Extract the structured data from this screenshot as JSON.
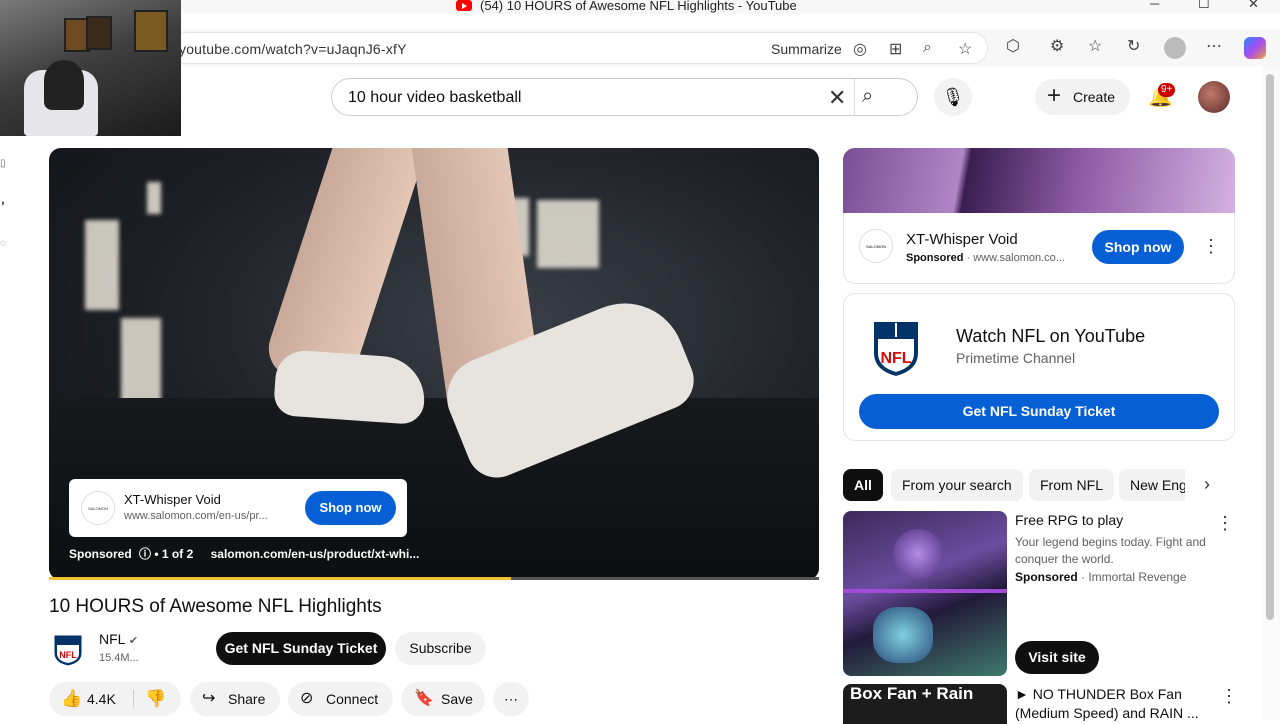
{
  "window": {
    "title": "(54) 10 HOURS of Awesome NFL Highlights - YouTube",
    "minimize": "─",
    "maximize": "☐",
    "close": "✕"
  },
  "browser": {
    "url": "youtube.com/watch?v=uJaqnJ6-xfY",
    "summarize": "Summarize"
  },
  "header": {
    "search_value": "10 hour video basketball",
    "create_label": "Create",
    "notif_badge": "9+"
  },
  "player": {
    "ad_title": "XT-Whisper Void",
    "ad_url": "www.salomon.com/en-us/pr...",
    "ad_logo": "SALOMON",
    "ad_button": "Shop now",
    "sponsored": "Sponsored",
    "ad_count": "• 1 of 2",
    "ad_link": "salomon.com/en-us/product/xt-whi...",
    "progress": 0.6
  },
  "video": {
    "title": "10 HOURS of Awesome NFL Highlights",
    "channel": "NFL",
    "subs": "15.4M...",
    "ticket_button": "Get NFL Sunday Ticket",
    "subscribe_button": "Subscribe"
  },
  "actions": {
    "likes": "4.4K",
    "share": "Share",
    "connect": "Connect",
    "save": "Save"
  },
  "sidebar": {
    "promo": {
      "title": "XT-Whisper Void",
      "sponsored": "Sponsored",
      "url": " · www.salomon.co...",
      "button": "Shop now",
      "logo": "SALOMON"
    },
    "nfl": {
      "title": "Watch NFL on YouTube",
      "subtitle": "Primetime Channel",
      "button": "Get NFL Sunday Ticket"
    },
    "chips": [
      "All",
      "From your search",
      "From NFL",
      "New Eng"
    ],
    "rec1": {
      "title": "Free RPG to play",
      "desc": "Your legend begins today. Fight and conquer the world.",
      "sponsored": "Sponsored",
      "advertiser": " · Immortal Revenge",
      "button": "Visit site"
    },
    "rec2": {
      "thumb_text": "Box Fan + Rain",
      "title": "► NO THUNDER Box Fan (Medium Speed) and RAIN ..."
    }
  },
  "colors": {
    "accent_blue": "#065fd4",
    "brand_red": "#ff0000",
    "progress_yellow": "#f2c230"
  }
}
